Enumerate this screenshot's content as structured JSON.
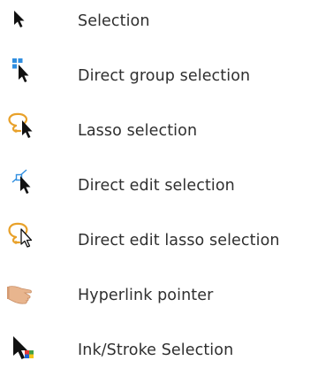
{
  "tools": [
    {
      "label": "Selection",
      "icon": "arrow-cursor-icon"
    },
    {
      "label": "Direct group selection",
      "icon": "group-selection-cursor-icon"
    },
    {
      "label": "Lasso selection",
      "icon": "lasso-cursor-icon"
    },
    {
      "label": "Direct edit selection",
      "icon": "direct-edit-cursor-icon"
    },
    {
      "label": "Direct edit lasso selection",
      "icon": "direct-edit-lasso-cursor-icon"
    },
    {
      "label": "Hyperlink pointer",
      "icon": "hand-pointer-icon"
    },
    {
      "label": "Ink/Stroke Selection",
      "icon": "ink-stroke-cursor-icon"
    }
  ],
  "colors": {
    "text": "#2f2f2f",
    "cursor": "#111111",
    "accent_blue": "#2f8ee0",
    "lasso_orange": "#e8a12a",
    "hand_skin": "#e8b58e"
  }
}
